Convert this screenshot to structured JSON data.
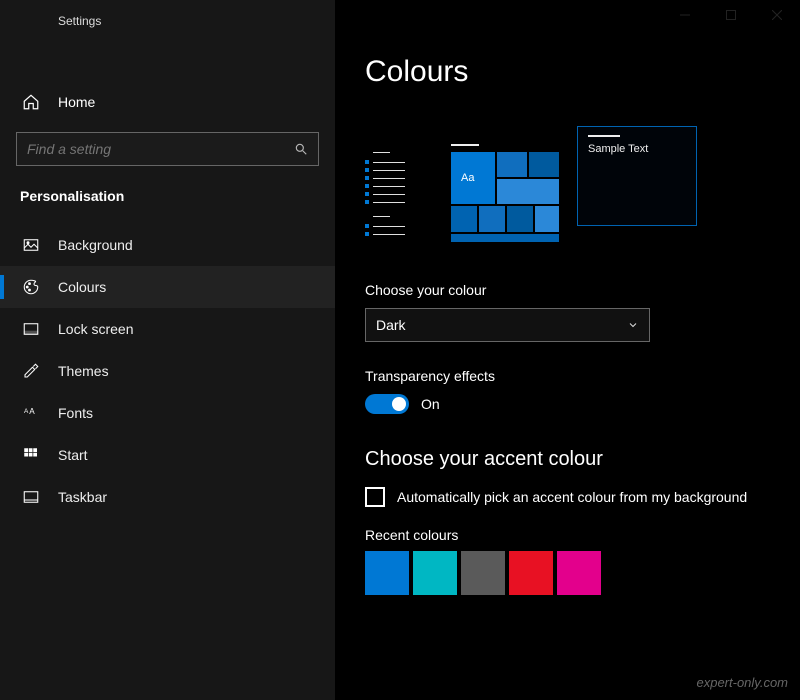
{
  "app": {
    "title": "Settings"
  },
  "home": {
    "label": "Home"
  },
  "search": {
    "placeholder": "Find a setting"
  },
  "section": {
    "label": "Personalisation"
  },
  "nav": {
    "items": [
      {
        "label": "Background",
        "icon": "image-icon"
      },
      {
        "label": "Colours",
        "icon": "palette-icon"
      },
      {
        "label": "Lock screen",
        "icon": "lock-screen-icon"
      },
      {
        "label": "Themes",
        "icon": "themes-icon"
      },
      {
        "label": "Fonts",
        "icon": "fonts-icon"
      },
      {
        "label": "Start",
        "icon": "start-icon"
      },
      {
        "label": "Taskbar",
        "icon": "taskbar-icon"
      }
    ],
    "selected_index": 1
  },
  "page": {
    "title": "Colours",
    "preview": {
      "aa": "Aa",
      "sample_text": "Sample Text"
    },
    "choose_colour": {
      "label": "Choose your colour",
      "value": "Dark"
    },
    "transparency": {
      "label": "Transparency effects",
      "state_text": "On",
      "on": true
    },
    "accent": {
      "heading": "Choose your accent colour",
      "auto_label": "Automatically pick an accent colour from my background",
      "auto_checked": false,
      "recent_label": "Recent colours",
      "recent": [
        "#0078d4",
        "#00b7c3",
        "#5a5a5a",
        "#e81123",
        "#e3008c"
      ]
    }
  },
  "watermark": "expert-only.com"
}
